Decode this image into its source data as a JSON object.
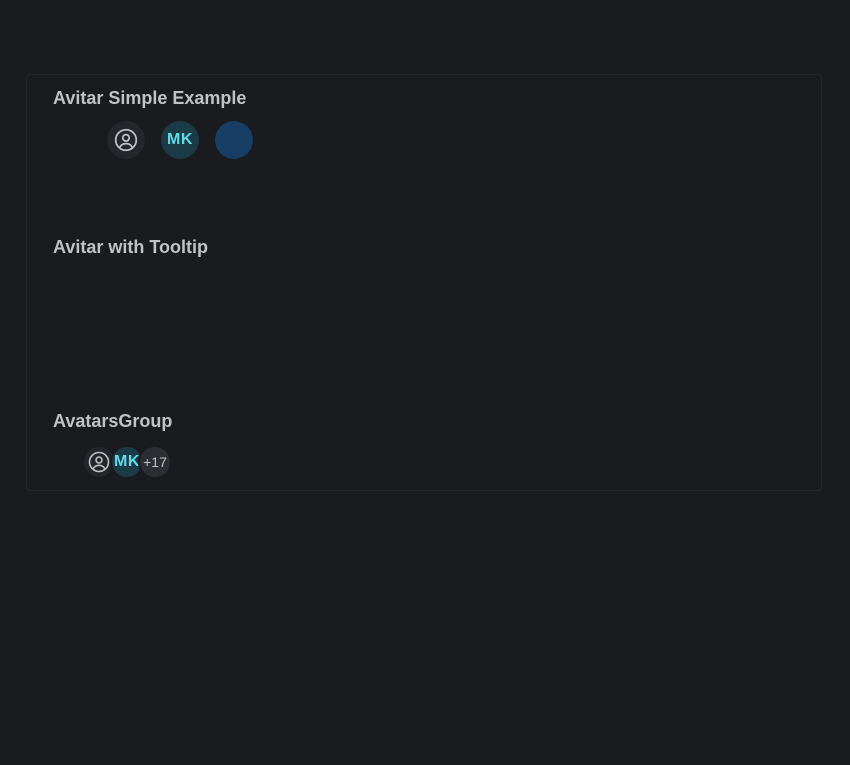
{
  "sections": {
    "simple": {
      "title": "Avitar Simple Example",
      "avatars": [
        {
          "type": "placeholder",
          "icon": "user-circle-icon"
        },
        {
          "type": "initials",
          "label": "MK",
          "color": "#66d9e8",
          "background": "#1b3b46"
        },
        {
          "type": "color",
          "background": "#173e64"
        }
      ]
    },
    "tooltip": {
      "title": "Avitar with Tooltip"
    },
    "group": {
      "title": "AvatarsGroup",
      "avatars": [
        {
          "type": "placeholder",
          "icon": "user-circle-icon"
        },
        {
          "type": "initials",
          "label": "MK"
        }
      ],
      "more_label": "+17"
    }
  },
  "colors": {
    "page_background": "#1a1b1e",
    "card_border": "#25262b",
    "title_text": "#c1c2c5",
    "initials_text": "#66d9e8",
    "initials_bg": "#1b3b46",
    "blue_avatar_bg": "#173e64",
    "placeholder_bg": "#25262b"
  }
}
